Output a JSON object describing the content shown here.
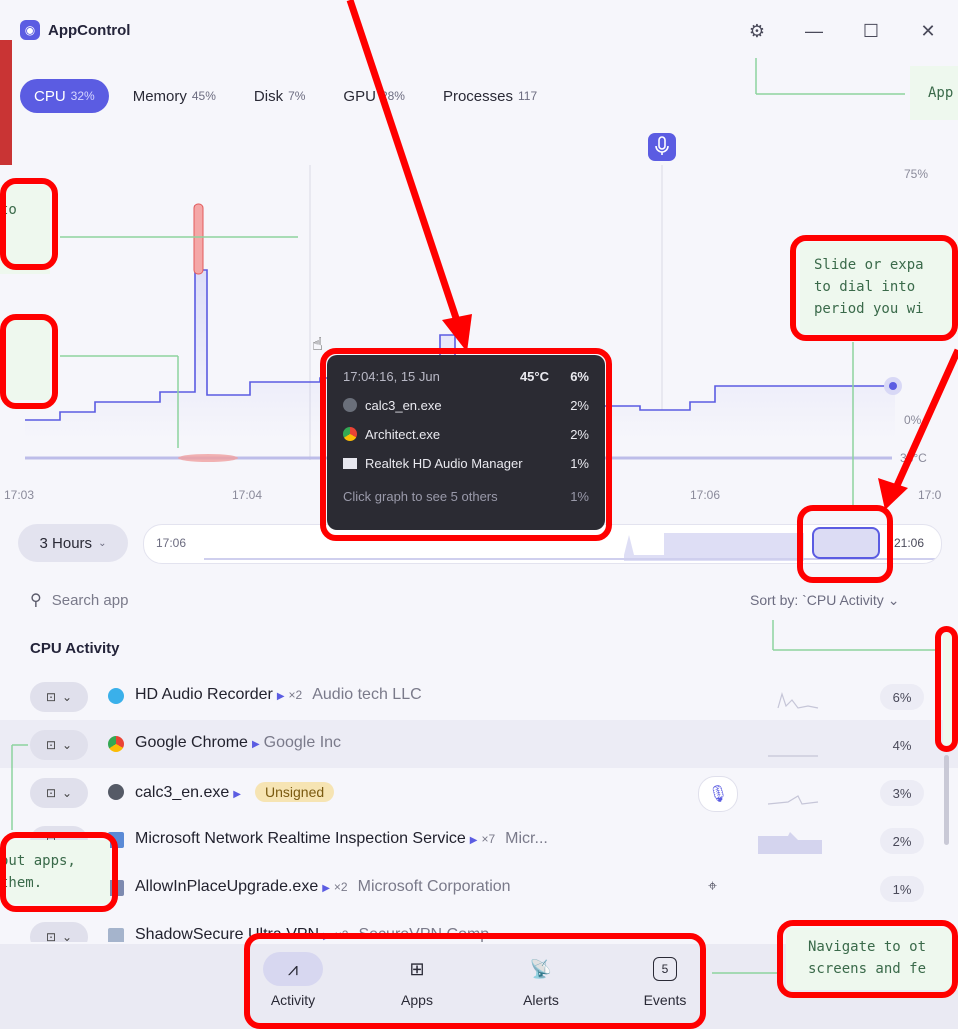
{
  "app": {
    "title": "AppControl"
  },
  "tabs": [
    {
      "label": "CPU",
      "value": "32%"
    },
    {
      "label": "Memory",
      "value": "45%"
    },
    {
      "label": "Disk",
      "value": "7%"
    },
    {
      "label": "GPU",
      "value": "28%"
    },
    {
      "label": "Processes",
      "value": "117"
    }
  ],
  "chart": {
    "y_labels": {
      "top": "75%",
      "bottom": "0%",
      "temp": "38°C"
    },
    "x_labels": [
      "17:03",
      "17:04",
      "17:06",
      "17:0"
    ]
  },
  "tooltip": {
    "time": "17:04:16, 15 Jun",
    "temp": "45°C",
    "total": "6%",
    "items": [
      {
        "name": "calc3_en.exe",
        "value": "2%"
      },
      {
        "name": "Architect.exe",
        "value": "2%"
      },
      {
        "name": "Realtek HD Audio Manager",
        "value": "1%"
      }
    ],
    "footer": "Click graph to see 5 others",
    "footer_value": "1%"
  },
  "range": {
    "button": "3 Hours",
    "start": "17:06",
    "end": "21:06"
  },
  "search": {
    "placeholder": "Search app"
  },
  "sort": {
    "label": "Sort by: `CPU Activity"
  },
  "section": {
    "title": "CPU Activity"
  },
  "apps": [
    {
      "name": "HD Audio Recorder",
      "count": "×2",
      "vendor": "Audio tech LLC",
      "pct": "6%"
    },
    {
      "name": "Google Chrome",
      "count": "",
      "vendor": "Google Inc",
      "pct": "4%"
    },
    {
      "name": "calc3_en.exe",
      "badge": "Unsigned",
      "pct": "3%"
    },
    {
      "name": "Microsoft Network Realtime Inspection Service",
      "count": "×7",
      "vendor": "Micr...",
      "pct": "2%"
    },
    {
      "name": "AllowInPlaceUpgrade.exe",
      "count": "×2",
      "vendor": "Microsoft Corporation",
      "pct": "1%"
    },
    {
      "name": "ShadowSecure Ultra VPN",
      "count": "×2",
      "vendor": "SecureVPN Comp"
    }
  ],
  "nav": [
    {
      "label": "Activity"
    },
    {
      "label": "Apps"
    },
    {
      "label": "Alerts"
    },
    {
      "label": "Events",
      "badge": "5"
    }
  ],
  "notes": {
    "n1": "to\n.",
    "n2": "Slide or expa\nto dial into\nperiod you wi",
    "n3": "App",
    "n4": "out apps,\nthem.",
    "n5": "Navigate to ot\nscreens and fe"
  },
  "colors": {
    "accent": "#5b5ce2",
    "annotation": "#ff0000"
  }
}
